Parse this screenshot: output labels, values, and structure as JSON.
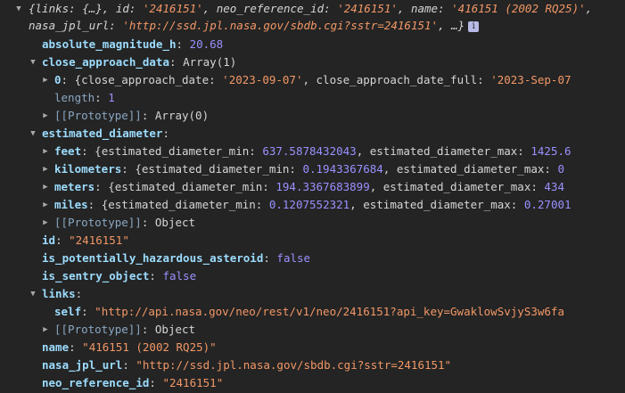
{
  "header": {
    "preview_part1": "{links: {…}, id: ",
    "id_value": "'2416151'",
    "preview_part2": ", neo_reference_id: ",
    "neo_ref_value": "'2416151'",
    "preview_part3": ", name: ",
    "name_value": "'416151 (2002 RQ25)'",
    "preview_part4": ", nasa_jpl_url: ",
    "url_value": "'http://ssd.jpl.nasa.gov/sbdb.cgi?sstr=2416151'",
    "preview_part5": ", …}",
    "info_glyph": "i"
  },
  "rows": {
    "absolute_magnitude_h": {
      "key": "absolute_magnitude_h",
      "value": "20.68"
    },
    "close_approach_data": {
      "key": "close_approach_data",
      "value": "Array(1)"
    },
    "cad_0": {
      "key": "0",
      "p1": "{close_approach_date: ",
      "v1": "'2023-09-07'",
      "p2": ", close_approach_date_full: ",
      "v2": "'2023-Sep-07"
    },
    "cad_length": {
      "key": "length",
      "value": "1"
    },
    "cad_proto": {
      "key": "[[Prototype]]",
      "value": "Array(0)"
    },
    "estimated_diameter": {
      "key": "estimated_diameter"
    },
    "feet": {
      "key": "feet",
      "p1": "{estimated_diameter_min: ",
      "v1": "637.5878432043",
      "p2": ", estimated_diameter_max: ",
      "v2": "1425.6"
    },
    "kilometers": {
      "key": "kilometers",
      "p1": "{estimated_diameter_min: ",
      "v1": "0.1943367684",
      "p2": ", estimated_diameter_max: ",
      "v2": "0"
    },
    "meters": {
      "key": "meters",
      "p1": "{estimated_diameter_min: ",
      "v1": "194.3367683899",
      "p2": ", estimated_diameter_max: ",
      "v2": "434"
    },
    "miles": {
      "key": "miles",
      "p1": "{estimated_diameter_min: ",
      "v1": "0.1207552321",
      "p2": ", estimated_diameter_max: ",
      "v2": "0.27001"
    },
    "ed_proto": {
      "key": "[[Prototype]]",
      "value": "Object"
    },
    "id": {
      "key": "id",
      "value": "\"2416151\""
    },
    "is_potentially_hazardous_asteroid": {
      "key": "is_potentially_hazardous_asteroid",
      "value": "false"
    },
    "is_sentry_object": {
      "key": "is_sentry_object",
      "value": "false"
    },
    "links": {
      "key": "links"
    },
    "self": {
      "key": "self",
      "value": "\"http://api.nasa.gov/neo/rest/v1/neo/2416151?api_key=GwaklowSvjyS3w6fa"
    },
    "links_proto": {
      "key": "[[Prototype]]",
      "value": "Object"
    },
    "name": {
      "key": "name",
      "value": "\"416151 (2002 RQ25)\""
    },
    "nasa_jpl_url": {
      "key": "nasa_jpl_url",
      "value": "\"http://ssd.jpl.nasa.gov/sbdb.cgi?sstr=2416151\""
    },
    "neo_reference_id": {
      "key": "neo_reference_id",
      "value": "\"2416151\""
    }
  },
  "colors": {
    "background": "#242424",
    "key": "#9cdcfe",
    "string": "#f29766",
    "number": "#9a91ff",
    "text": "#d5d5d5"
  }
}
